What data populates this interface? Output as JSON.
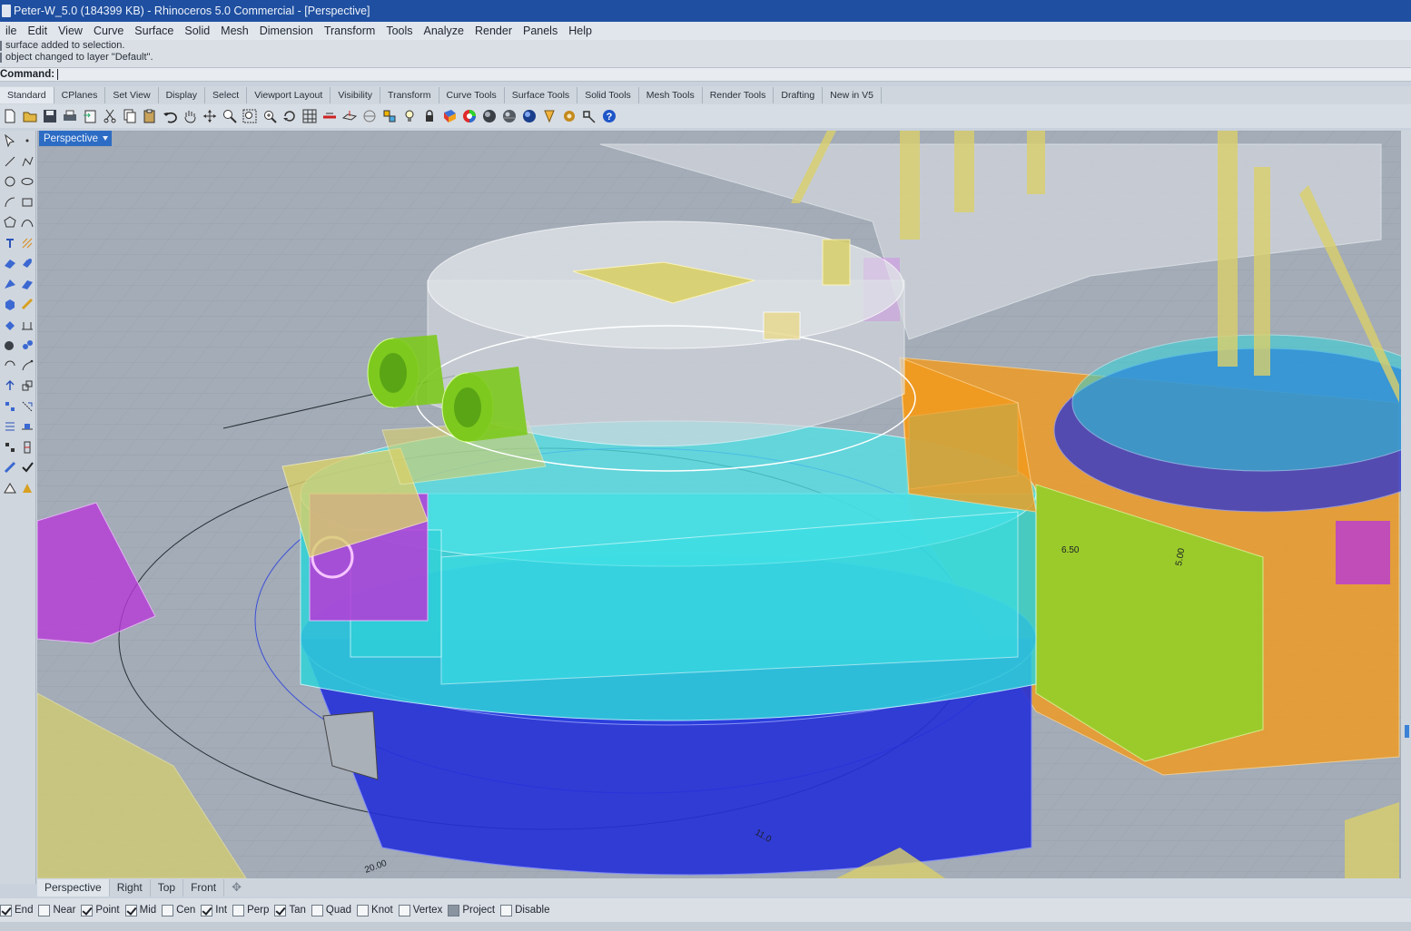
{
  "window": {
    "title": "Peter-W_5.0 (184399 KB) - Rhinoceros 5.0 Commercial - [Perspective]"
  },
  "menu": [
    "ile",
    "Edit",
    "View",
    "Curve",
    "Surface",
    "Solid",
    "Mesh",
    "Dimension",
    "Transform",
    "Tools",
    "Analyze",
    "Render",
    "Panels",
    "Help"
  ],
  "history": {
    "line1": "surface added to selection.",
    "line2": "object changed to layer \"Default\"."
  },
  "command": {
    "label": "Command:",
    "value": ""
  },
  "toolbar_tabs": [
    "Standard",
    "CPlanes",
    "Set View",
    "Display",
    "Select",
    "Viewport Layout",
    "Visibility",
    "Transform",
    "Curve Tools",
    "Surface Tools",
    "Solid Tools",
    "Mesh Tools",
    "Render Tools",
    "Drafting",
    "New in V5"
  ],
  "toolbar_icons": [
    "new-file-icon",
    "open-folder-icon",
    "save-icon",
    "print-icon",
    "import-icon",
    "cut-icon",
    "copy-icon",
    "paste-icon",
    "undo-icon",
    "pan-hand-icon",
    "move-icon",
    "zoom-icon",
    "zoom-window-icon",
    "zoom-extents-icon",
    "rotate-view-icon",
    "grid-icon",
    "snapshot-icon",
    "cplane-icon",
    "named-views-icon",
    "light-icon",
    "lock-icon",
    "layer-icon",
    "color-wheel-icon",
    "render-sphere-icon",
    "render-preview-icon",
    "material-sphere-icon",
    "highlight-icon",
    "settings-gear-icon",
    "tools-icon",
    "help-icon"
  ],
  "viewport": {
    "active_name": "Perspective",
    "dimension_labels": [
      "6.50",
      "5.00",
      "20.00",
      "11.0"
    ]
  },
  "viewport_tabs": [
    "Perspective",
    "Right",
    "Top",
    "Front"
  ],
  "osnap": [
    {
      "label": "End",
      "checked": true
    },
    {
      "label": "Near",
      "checked": false
    },
    {
      "label": "Point",
      "checked": true
    },
    {
      "label": "Mid",
      "checked": true
    },
    {
      "label": "Cen",
      "checked": false
    },
    {
      "label": "Int",
      "checked": true
    },
    {
      "label": "Perp",
      "checked": false
    },
    {
      "label": "Tan",
      "checked": true
    },
    {
      "label": "Quad",
      "checked": false
    },
    {
      "label": "Knot",
      "checked": false
    },
    {
      "label": "Vertex",
      "checked": false
    },
    {
      "label": "Project",
      "checked": "partial"
    },
    {
      "label": "Disable",
      "checked": false
    }
  ],
  "colors": {
    "titlebar": "#1f4fa0",
    "viewport_bg": "#9fa8b3",
    "cyan": "#2fd3d9",
    "blue": "#2530d8",
    "orange": "#f39a1c",
    "green": "#8fd428",
    "magenta": "#b73ad8",
    "yellow": "#d9d06a"
  }
}
